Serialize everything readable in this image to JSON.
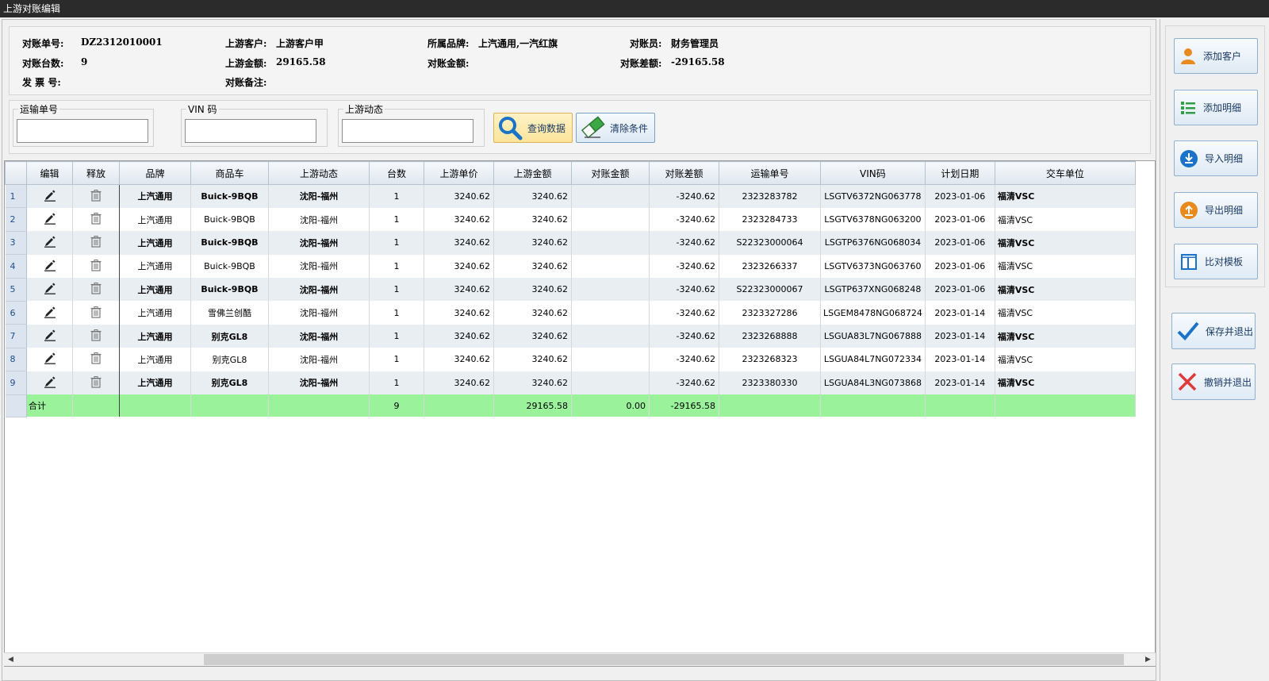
{
  "window": {
    "title": "上游对账编辑"
  },
  "info": {
    "recon_no_label": "对账单号:",
    "recon_no": "DZ2312010001",
    "customer_label": "上游客户:",
    "customer": "上游客户甲",
    "brand_label": "所属品牌:",
    "brand": "上汽通用,一汽红旗",
    "clerk_label": "对账员:",
    "clerk": "财务管理员",
    "count_label": "对账台数:",
    "count": "9",
    "upstream_amount_label": "上游金额:",
    "upstream_amount": "29165.58",
    "recon_amount_label": "对账金额:",
    "recon_amount": "",
    "diff_label": "对账差额:",
    "diff": "-29165.58",
    "invoice_label": "发 票 号:",
    "invoice": "",
    "remark_label": "对账备注:",
    "remark": ""
  },
  "filters": {
    "transport_no": {
      "label": "运输单号",
      "value": "",
      "placeholder": ""
    },
    "vin": {
      "label": "VIN 码",
      "value": "",
      "placeholder": ""
    },
    "upstream_status": {
      "label": "上游动态",
      "value": "",
      "placeholder": ""
    },
    "query_label": "查询数据",
    "clear_label": "清除条件"
  },
  "table": {
    "columns": [
      "编辑",
      "释放",
      "品牌",
      "商品车",
      "上游动态",
      "台数",
      "上游单价",
      "上游金额",
      "对账金额",
      "对账差额",
      "运输单号",
      "VIN码",
      "计划日期",
      "交车单位"
    ],
    "rows": [
      {
        "no": "1",
        "brand": "上汽通用",
        "car": "Buick-9BQB",
        "status": "沈阳-福州",
        "qty": "1",
        "price": "3240.62",
        "amount": "3240.62",
        "recon": "",
        "diff": "-3240.62",
        "transport": "2323283782",
        "vin": "LSGTV6372NG063778",
        "date": "2023-01-06",
        "unit": "福清VSC"
      },
      {
        "no": "2",
        "brand": "上汽通用",
        "car": "Buick-9BQB",
        "status": "沈阳-福州",
        "qty": "1",
        "price": "3240.62",
        "amount": "3240.62",
        "recon": "",
        "diff": "-3240.62",
        "transport": "2323284733",
        "vin": "LSGTV6378NG063200",
        "date": "2023-01-06",
        "unit": "福清VSC"
      },
      {
        "no": "3",
        "brand": "上汽通用",
        "car": "Buick-9BQB",
        "status": "沈阳-福州",
        "qty": "1",
        "price": "3240.62",
        "amount": "3240.62",
        "recon": "",
        "diff": "-3240.62",
        "transport": "S22323000064",
        "vin": "LSGTP6376NG068034",
        "date": "2023-01-06",
        "unit": "福清VSC"
      },
      {
        "no": "4",
        "brand": "上汽通用",
        "car": "Buick-9BQB",
        "status": "沈阳-福州",
        "qty": "1",
        "price": "3240.62",
        "amount": "3240.62",
        "recon": "",
        "diff": "-3240.62",
        "transport": "2323266337",
        "vin": "LSGTV6373NG063760",
        "date": "2023-01-06",
        "unit": "福清VSC"
      },
      {
        "no": "5",
        "brand": "上汽通用",
        "car": "Buick-9BQB",
        "status": "沈阳-福州",
        "qty": "1",
        "price": "3240.62",
        "amount": "3240.62",
        "recon": "",
        "diff": "-3240.62",
        "transport": "S22323000067",
        "vin": "LSGTP637XNG068248",
        "date": "2023-01-06",
        "unit": "福清VSC"
      },
      {
        "no": "6",
        "brand": "上汽通用",
        "car": "雪佛兰创酷",
        "status": "沈阳-福州",
        "qty": "1",
        "price": "3240.62",
        "amount": "3240.62",
        "recon": "",
        "diff": "-3240.62",
        "transport": "2323327286",
        "vin": "LSGEM8478NG068724",
        "date": "2023-01-14",
        "unit": "福清VSC"
      },
      {
        "no": "7",
        "brand": "上汽通用",
        "car": "别克GL8",
        "status": "沈阳-福州",
        "qty": "1",
        "price": "3240.62",
        "amount": "3240.62",
        "recon": "",
        "diff": "-3240.62",
        "transport": "2323268888",
        "vin": "LSGUA83L7NG067888",
        "date": "2023-01-14",
        "unit": "福清VSC"
      },
      {
        "no": "8",
        "brand": "上汽通用",
        "car": "别克GL8",
        "status": "沈阳-福州",
        "qty": "1",
        "price": "3240.62",
        "amount": "3240.62",
        "recon": "",
        "diff": "-3240.62",
        "transport": "2323268323",
        "vin": "LSGUA84L7NG072334",
        "date": "2023-01-14",
        "unit": "福清VSC"
      },
      {
        "no": "9",
        "brand": "上汽通用",
        "car": "别克GL8",
        "status": "沈阳-福州",
        "qty": "1",
        "price": "3240.62",
        "amount": "3240.62",
        "recon": "",
        "diff": "-3240.62",
        "transport": "2323380330",
        "vin": "LSGUA84L3NG073868",
        "date": "2023-01-14",
        "unit": "福清VSC"
      }
    ],
    "total": {
      "label": "合计",
      "qty": "9",
      "amount": "29165.58",
      "recon": "0.00",
      "diff": "-29165.58"
    }
  },
  "sidebar": {
    "add_customer": "添加客户",
    "add_detail": "添加明细",
    "import_detail": "导入明细",
    "export_detail": "导出明细",
    "compare_template": "比对模板",
    "save_exit": "保存并退出",
    "cancel_exit": "撤销并退出"
  },
  "colors": {
    "total_row": "#9af39a",
    "titlebar": "#2b2b2b",
    "accent_blue": "#1a73c8",
    "orange_icon": "#e98a1e",
    "green_icon": "#2f9e44",
    "red_icon": "#e03a3a"
  }
}
